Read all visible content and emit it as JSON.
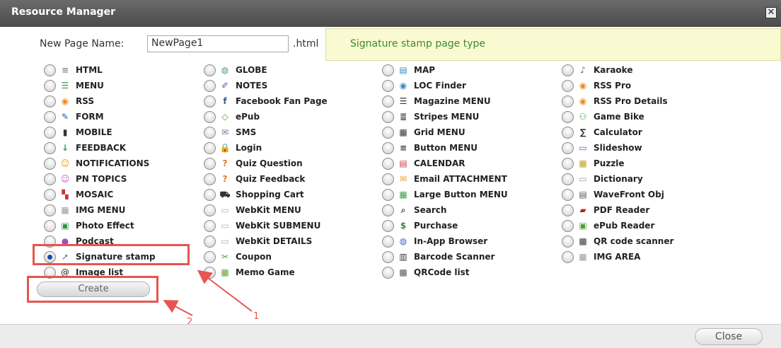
{
  "window": {
    "title": "Resource Manager",
    "close_glyph": "✕"
  },
  "form": {
    "name_label": "New Page Name:",
    "name_value": "NewPage1",
    "extension": ".html",
    "info_text": "Signature stamp page type"
  },
  "columns": [
    {
      "items": [
        {
          "label": "HTML",
          "icon": "html-icon",
          "glyph": "≡",
          "color": "#7a8a9a"
        },
        {
          "label": "MENU",
          "icon": "menu-icon",
          "glyph": "☰",
          "color": "#3a9a4a"
        },
        {
          "label": "RSS",
          "icon": "rss-icon",
          "glyph": "◉",
          "color": "#f08a20"
        },
        {
          "label": "FORM",
          "icon": "form-pencil-icon",
          "glyph": "✎",
          "color": "#1a5ab0"
        },
        {
          "label": "MOBILE",
          "icon": "mobile-phone-icon",
          "glyph": "▮",
          "color": "#333333"
        },
        {
          "label": "FEEDBACK",
          "icon": "feedback-icon",
          "glyph": "↓",
          "color": "#3aa04a"
        },
        {
          "label": "NOTIFICATIONS",
          "icon": "notifications-icon",
          "glyph": "☺",
          "color": "#e0a020"
        },
        {
          "label": "PN TOPICS",
          "icon": "pn-topics-icon",
          "glyph": "☺",
          "color": "#c060c0"
        },
        {
          "label": "MOSAIC",
          "icon": "mosaic-icon",
          "glyph": "▚",
          "color": "#d03030"
        },
        {
          "label": "IMG MENU",
          "icon": "img-menu-icon",
          "glyph": "▦",
          "color": "#9a9a9a"
        },
        {
          "label": "Photo Effect",
          "icon": "photo-effect-icon",
          "glyph": "▣",
          "color": "#2a9a3a"
        },
        {
          "label": "Podcast",
          "icon": "podcast-icon",
          "glyph": "●",
          "color": "#a050c0"
        },
        {
          "label": "Signature stamp",
          "icon": "signature-stamp-icon",
          "glyph": "➚",
          "color": "#5a7ab0",
          "selected": true
        },
        {
          "label": "Image list",
          "icon": "image-list-icon",
          "glyph": "@",
          "color": "#555555"
        }
      ]
    },
    {
      "items": [
        {
          "label": "GLOBE",
          "icon": "globe-icon",
          "glyph": "◍",
          "color": "#4a9a8a"
        },
        {
          "label": "NOTES",
          "icon": "notes-icon",
          "glyph": "✐",
          "color": "#4a6ab0"
        },
        {
          "label": "Facebook Fan Page",
          "icon": "facebook-icon",
          "glyph": "f",
          "color": "#3b5998"
        },
        {
          "label": "ePub",
          "icon": "epub-icon",
          "glyph": "◇",
          "color": "#4aa02a"
        },
        {
          "label": "SMS",
          "icon": "sms-envelope-icon",
          "glyph": "✉",
          "color": "#6a7a9a"
        },
        {
          "label": "Login",
          "icon": "login-lock-icon",
          "glyph": "🔒",
          "color": "#d0a020"
        },
        {
          "label": "Quiz Question",
          "icon": "quiz-question-icon",
          "glyph": "?",
          "color": "#e07a20"
        },
        {
          "label": "Quiz Feedback",
          "icon": "quiz-feedback-icon",
          "glyph": "?",
          "color": "#e07a20"
        },
        {
          "label": "Shopping Cart",
          "icon": "shopping-cart-icon",
          "glyph": "⛟",
          "color": "#333333"
        },
        {
          "label": "WebKit MENU",
          "icon": "webkit-menu-icon",
          "glyph": "▭",
          "color": "#b0b0b0"
        },
        {
          "label": "WebKit SUBMENU",
          "icon": "webkit-submenu-icon",
          "glyph": "▭",
          "color": "#b0b0b0"
        },
        {
          "label": "WebKit DETAILS",
          "icon": "webkit-details-icon",
          "glyph": "▭",
          "color": "#b0b0b0"
        },
        {
          "label": "Coupon",
          "icon": "coupon-scissors-icon",
          "glyph": "✂",
          "color": "#4aa02a"
        },
        {
          "label": "Memo Game",
          "icon": "memo-game-icon",
          "glyph": "▦",
          "color": "#6aa02a"
        }
      ]
    },
    {
      "items": [
        {
          "label": "MAP",
          "icon": "map-icon",
          "glyph": "▤",
          "color": "#3a8ac0"
        },
        {
          "label": "LOC Finder",
          "icon": "loc-finder-icon",
          "glyph": "◉",
          "color": "#3a8ac0"
        },
        {
          "label": "Magazine MENU",
          "icon": "magazine-menu-icon",
          "glyph": "☰",
          "color": "#333333"
        },
        {
          "label": "Stripes MENU",
          "icon": "stripes-menu-icon",
          "glyph": "≣",
          "color": "#333333"
        },
        {
          "label": "Grid MENU",
          "icon": "grid-menu-icon",
          "glyph": "▦",
          "color": "#333333"
        },
        {
          "label": "Button MENU",
          "icon": "button-menu-icon",
          "glyph": "≡",
          "color": "#333333"
        },
        {
          "label": "CALENDAR",
          "icon": "calendar-icon",
          "glyph": "▤",
          "color": "#c04040"
        },
        {
          "label": "Email ATTACHMENT",
          "icon": "email-attachment-icon",
          "glyph": "✉",
          "color": "#e0a020"
        },
        {
          "label": "Large Button MENU",
          "icon": "large-button-menu-icon",
          "glyph": "▦",
          "color": "#3aa04a"
        },
        {
          "label": "Search",
          "icon": "search-icon",
          "glyph": "⌕",
          "color": "#555555"
        },
        {
          "label": "Purchase",
          "icon": "purchase-icon",
          "glyph": "$",
          "color": "#3a8a3a"
        },
        {
          "label": "In-App Browser",
          "icon": "in-app-browser-icon",
          "glyph": "◍",
          "color": "#3a6ac0"
        },
        {
          "label": "Barcode Scanner",
          "icon": "barcode-scanner-icon",
          "glyph": "▥",
          "color": "#333333"
        },
        {
          "label": "QRCode list",
          "icon": "qrcode-list-icon",
          "glyph": "▩",
          "color": "#555555"
        }
      ]
    },
    {
      "items": [
        {
          "label": "Karaoke",
          "icon": "karaoke-microphone-icon",
          "glyph": "♪",
          "color": "#666666"
        },
        {
          "label": "RSS Pro",
          "icon": "rss-pro-icon",
          "glyph": "◉",
          "color": "#f08a20"
        },
        {
          "label": "RSS Pro Details",
          "icon": "rss-pro-details-icon",
          "glyph": "◉",
          "color": "#f08a20"
        },
        {
          "label": "Game Bike",
          "icon": "game-bike-icon",
          "glyph": "⚇",
          "color": "#3aa04a"
        },
        {
          "label": "Calculator",
          "icon": "calculator-sigma-icon",
          "glyph": "∑",
          "color": "#333333"
        },
        {
          "label": "Slideshow",
          "icon": "slideshow-icon",
          "glyph": "▭",
          "color": "#3a6ac0"
        },
        {
          "label": "Puzzle",
          "icon": "puzzle-icon",
          "glyph": "▦",
          "color": "#c0a020"
        },
        {
          "label": "Dictionary",
          "icon": "dictionary-icon",
          "glyph": "▭",
          "color": "#9a9a9a"
        },
        {
          "label": "WaveFront Obj",
          "icon": "wavefront-obj-icon",
          "glyph": "▤",
          "color": "#555555"
        },
        {
          "label": "PDF Reader",
          "icon": "pdf-reader-icon",
          "glyph": "▰",
          "color": "#c02020"
        },
        {
          "label": "ePub Reader",
          "icon": "epub-reader-icon",
          "glyph": "▣",
          "color": "#4aa02a"
        },
        {
          "label": "QR code scanner",
          "icon": "qr-code-scanner-icon",
          "glyph": "▩",
          "color": "#333333"
        },
        {
          "label": "IMG AREA",
          "icon": "img-area-icon",
          "glyph": "▦",
          "color": "#9a9a9a"
        }
      ]
    }
  ],
  "buttons": {
    "create": "Create",
    "close": "Close"
  },
  "annotations": [
    "1",
    "2"
  ],
  "colors": {
    "highlight": "#e8544f",
    "info_text": "#3d8a2e",
    "info_bg": "#fafad2"
  }
}
